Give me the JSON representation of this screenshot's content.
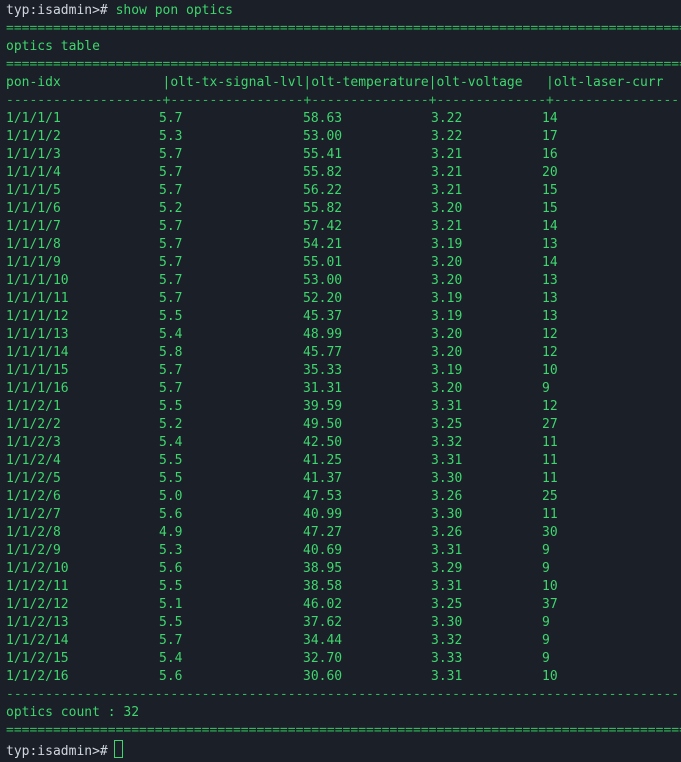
{
  "terminal": {
    "prompt": "typ:isadmin>#",
    "command": "show pon optics",
    "rule_double": "==========================================================================================================================",
    "rule_single": "------------------------------------------------------------------------------------------------------------------------------",
    "table_title": "optics table",
    "header_line": "pon-idx             |olt-tx-signal-lvl|olt-temperature|olt-voltage   |olt-laser-curr",
    "divider_line": "--------------------+-----------------+---------------+--------------+------------------------------",
    "rows": [
      [
        "1/1/1/1",
        "5.7",
        "58.63",
        "3.22",
        "14"
      ],
      [
        "1/1/1/2",
        "5.3",
        "53.00",
        "3.22",
        "17"
      ],
      [
        "1/1/1/3",
        "5.7",
        "55.41",
        "3.21",
        "16"
      ],
      [
        "1/1/1/4",
        "5.7",
        "55.82",
        "3.21",
        "20"
      ],
      [
        "1/1/1/5",
        "5.7",
        "56.22",
        "3.21",
        "15"
      ],
      [
        "1/1/1/6",
        "5.2",
        "55.82",
        "3.20",
        "15"
      ],
      [
        "1/1/1/7",
        "5.7",
        "57.42",
        "3.21",
        "14"
      ],
      [
        "1/1/1/8",
        "5.7",
        "54.21",
        "3.19",
        "13"
      ],
      [
        "1/1/1/9",
        "5.7",
        "55.01",
        "3.20",
        "14"
      ],
      [
        "1/1/1/10",
        "5.7",
        "53.00",
        "3.20",
        "13"
      ],
      [
        "1/1/1/11",
        "5.7",
        "52.20",
        "3.19",
        "13"
      ],
      [
        "1/1/1/12",
        "5.5",
        "45.37",
        "3.19",
        "13"
      ],
      [
        "1/1/1/13",
        "5.4",
        "48.99",
        "3.20",
        "12"
      ],
      [
        "1/1/1/14",
        "5.8",
        "45.77",
        "3.20",
        "12"
      ],
      [
        "1/1/1/15",
        "5.7",
        "35.33",
        "3.19",
        "10"
      ],
      [
        "1/1/1/16",
        "5.7",
        "31.31",
        "3.20",
        "9"
      ],
      [
        "1/1/2/1",
        "5.5",
        "39.59",
        "3.31",
        "12"
      ],
      [
        "1/1/2/2",
        "5.2",
        "49.50",
        "3.25",
        "27"
      ],
      [
        "1/1/2/3",
        "5.4",
        "42.50",
        "3.32",
        "11"
      ],
      [
        "1/1/2/4",
        "5.5",
        "41.25",
        "3.31",
        "11"
      ],
      [
        "1/1/2/5",
        "5.5",
        "41.37",
        "3.30",
        "11"
      ],
      [
        "1/1/2/6",
        "5.0",
        "47.53",
        "3.26",
        "25"
      ],
      [
        "1/1/2/7",
        "5.6",
        "40.99",
        "3.30",
        "11"
      ],
      [
        "1/1/2/8",
        "4.9",
        "47.27",
        "3.26",
        "30"
      ],
      [
        "1/1/2/9",
        "5.3",
        "40.69",
        "3.31",
        "9"
      ],
      [
        "1/1/2/10",
        "5.6",
        "38.95",
        "3.29",
        "9"
      ],
      [
        "1/1/2/11",
        "5.5",
        "38.58",
        "3.31",
        "10"
      ],
      [
        "1/1/2/12",
        "5.1",
        "46.02",
        "3.25",
        "37"
      ],
      [
        "1/1/2/13",
        "5.5",
        "37.62",
        "3.30",
        "9"
      ],
      [
        "1/1/2/14",
        "5.7",
        "34.44",
        "3.32",
        "9"
      ],
      [
        "1/1/2/15",
        "5.4",
        "32.70",
        "3.33",
        "9"
      ],
      [
        "1/1/2/16",
        "5.6",
        "30.60",
        "3.31",
        "10"
      ]
    ],
    "count_line": "optics count : 32"
  },
  "colors": {
    "background": "#1b1f27",
    "text": "#3ed66e",
    "prompt": "#cfd6de"
  }
}
